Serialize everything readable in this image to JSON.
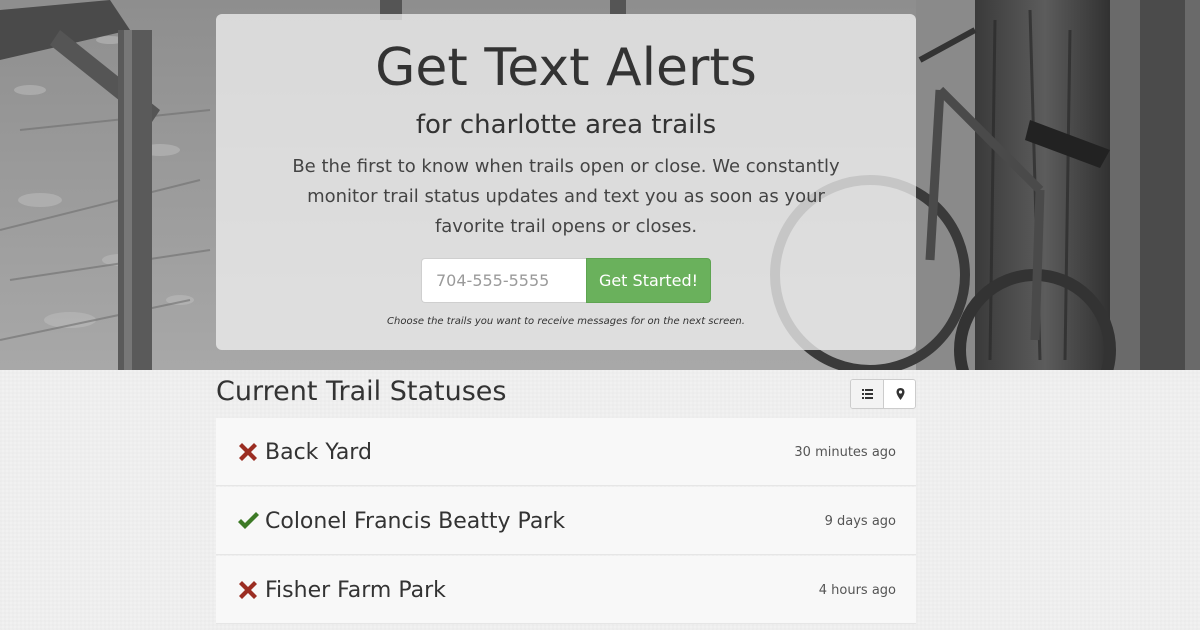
{
  "hero": {
    "title": "Get Text Alerts",
    "subtitle": "for charlotte area trails",
    "description": "Be the first to know when trails open or close. We constantly monitor trail status updates and text you as soon as your favorite trail opens or closes.",
    "phone_placeholder": "704-555-5555",
    "cta_label": "Get Started!",
    "note": "Choose the trails you want to receive messages for on the next screen."
  },
  "status": {
    "title": "Current Trail Statuses",
    "view_options": [
      {
        "icon": "list-icon"
      },
      {
        "icon": "map-marker-icon"
      }
    ]
  },
  "trails": [
    {
      "name": "Back Yard",
      "status": "closed",
      "updated": "30 minutes ago"
    },
    {
      "name": "Colonel Francis Beatty Park",
      "status": "open",
      "updated": "9 days ago"
    },
    {
      "name": "Fisher Farm Park",
      "status": "closed",
      "updated": "4 hours ago"
    }
  ],
  "colors": {
    "cta_green": "#6ab15c",
    "closed_red": "#9b2d22",
    "open_green": "#3d7a26"
  }
}
